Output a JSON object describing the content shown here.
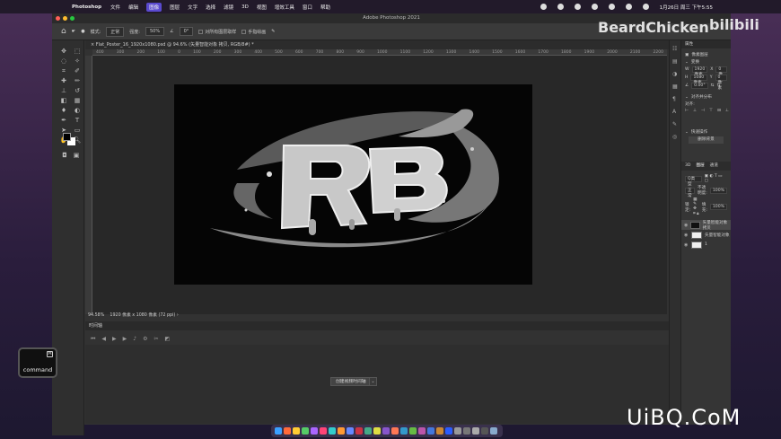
{
  "menubar": {
    "app": "Photoshop",
    "items": [
      "文件",
      "编辑",
      "图像",
      "图层",
      "文字",
      "选择",
      "滤镜",
      "3D",
      "视图",
      "增效工具",
      "窗口",
      "帮助"
    ],
    "active_index": 2,
    "clock": "1月26日 周三 下午5:55"
  },
  "window": {
    "title": "Adobe Photoshop 2021"
  },
  "options": {
    "mode_label": "模式:",
    "mode_value": "正常",
    "opacity_label": "强度:",
    "opacity_value": "50%",
    "angle_value": "0°",
    "sample_all": "对所有图层取样",
    "finger": "手指绘画"
  },
  "document": {
    "tab": "Flat_Poster_16_1920x1080.psd @ 94.6% (矢量智能对象 拷贝, RGB/8#) *",
    "ruler_ticks": [
      "400",
      "300",
      "200",
      "100",
      "0",
      "100",
      "200",
      "300",
      "400",
      "500",
      "600",
      "700",
      "800",
      "900",
      "1000",
      "1100",
      "1200",
      "1300",
      "1400",
      "1500",
      "1600",
      "1700",
      "1800",
      "1900",
      "2000",
      "2100",
      "2200"
    ],
    "zoom": "94.58%",
    "doc_info": "1920 像素 x 1080 像素 (72 ppi)"
  },
  "timeline": {
    "title": "时间轴",
    "create_label": "创建视频时间轴"
  },
  "command_key": {
    "label": "command"
  },
  "properties": {
    "title": "属性",
    "pixel_layer": "像素图层",
    "transform_title": "变换",
    "w_label": "W",
    "w_value": "1920 像素",
    "x_label": "X",
    "x_value": "0 像素",
    "h_label": "H",
    "h_value": "1080 像素",
    "y_label": "Y",
    "y_value": "0 像素",
    "angle": "0.00°",
    "align_title": "对齐并分布",
    "align_sub": "对齐:",
    "quick_title": "快速操作",
    "remove_bg": "删除背景"
  },
  "layers": {
    "tabs": [
      "3D",
      "图层",
      "通道"
    ],
    "active_tab": 1,
    "kind_label": "Q类型",
    "blend": "正常",
    "opacity_label": "不透明度:",
    "opacity_value": "100%",
    "lock_label": "锁定:",
    "fill_label": "填充:",
    "fill_value": "100%",
    "items": [
      {
        "name": "矢量智能对象 拷贝",
        "thumb": "dark",
        "selected": true
      },
      {
        "name": "矢量智能对象",
        "thumb": "light",
        "selected": false
      },
      {
        "name": "1",
        "thumb": "light",
        "selected": false
      }
    ]
  },
  "watermarks": {
    "brand": "BeardChicken",
    "bili": "bilibili",
    "site": "UiBQ.CoM"
  },
  "colors": {
    "menu_active": "#5a4ad0",
    "close": "#ff5f57",
    "minimize": "#febc2e",
    "zoom": "#28c840"
  }
}
